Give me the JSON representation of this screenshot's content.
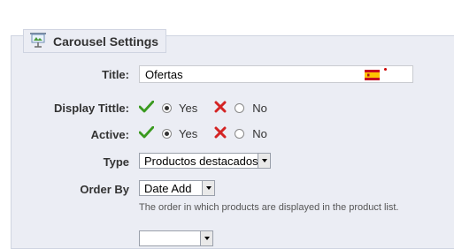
{
  "section": {
    "title": "Carousel Settings",
    "icon": "carousel-settings-icon"
  },
  "fields": {
    "title": {
      "label": "Title:",
      "value": "Ofertas",
      "flag_icon": "spain-flag-icon"
    },
    "display_title": {
      "label": "Display Tittle:",
      "yes_label": "Yes",
      "no_label": "No",
      "selected": "yes"
    },
    "active": {
      "label": "Active:",
      "yes_label": "Yes",
      "no_label": "No",
      "selected": "yes"
    },
    "type": {
      "label": "Type",
      "value": "Productos destacados"
    },
    "order_by": {
      "label": "Order By",
      "value": "Date Add",
      "hint": "The order in which products are displayed in the product list."
    }
  },
  "colors": {
    "panel_bg": "#ebedf4",
    "yes_check": "#3a9a1f",
    "no_cross": "#d42424"
  }
}
